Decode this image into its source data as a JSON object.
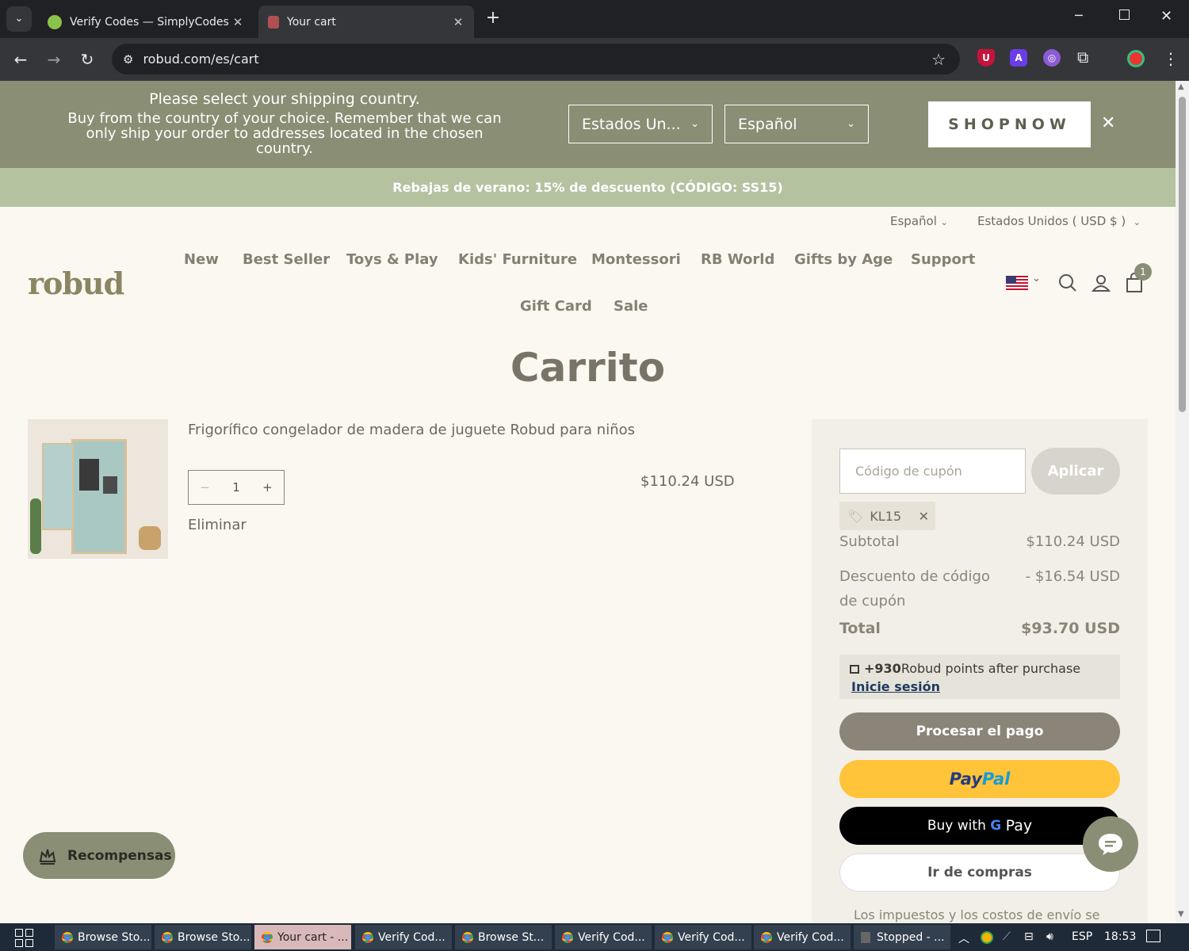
{
  "browser": {
    "tabs": [
      {
        "label": "Verify Codes — SimplyCodes"
      },
      {
        "label": "Your cart"
      }
    ],
    "url": "robud.com/es/cart"
  },
  "geo_banner": {
    "title": "Please select your shipping country.",
    "body": "Buy from the country of your choice. Remember that we can only ship your order to addresses located in the chosen country.",
    "country": "Estados Un...",
    "language": "Español",
    "shop_now": "SHOPNOW"
  },
  "promo": "Rebajas de verano: 15% de descuento (CÓDIGO: SS15)",
  "header": {
    "language": "Español",
    "country": "Estados Unidos ( USD $ )",
    "logo": "robud",
    "nav": [
      "New",
      "Best Seller",
      "Toys & Play",
      "Kids' Furniture",
      "Montessori",
      "RB World",
      "Gifts by Age",
      "Support",
      "Gift Card",
      "Sale"
    ],
    "cart_count": "1"
  },
  "page_title": "Carrito",
  "item": {
    "name": "Frigorífico congelador de madera de juguete Robud para niños",
    "qty": "1",
    "price": "$110.24 USD",
    "remove": "Eliminar"
  },
  "summary": {
    "coupon_placeholder": "Código de cupón",
    "apply": "Aplicar",
    "applied_code": "KL15",
    "subtotal_label": "Subtotal",
    "subtotal": "$110.24 USD",
    "discount_label": "Descuento de código de cupón",
    "discount": "- $16.54 USD",
    "total_label": "Total",
    "total": "$93.70 USD",
    "points_amount": "+930",
    "points_text": "Robud points after purchase",
    "login": "Inicie sesión",
    "checkout": "Procesar el pago",
    "paypal_a": "Pay",
    "paypal_b": "Pal",
    "gpay_a": "Buy with",
    "gpay_b": "Pay",
    "continue": "Ir de compras",
    "tax_note": "Los impuestos y los costos de envío se"
  },
  "rewards": "Recompensas",
  "taskbar": {
    "items": [
      "Browse Sto...",
      "Browse Sto...",
      "Your cart - ...",
      "Verify Cod...",
      "Browse St...",
      "Verify Cod...",
      "Verify Cod...",
      "Verify Cod...",
      "Stopped - ..."
    ],
    "lang": "ESP",
    "time": "18:53"
  }
}
